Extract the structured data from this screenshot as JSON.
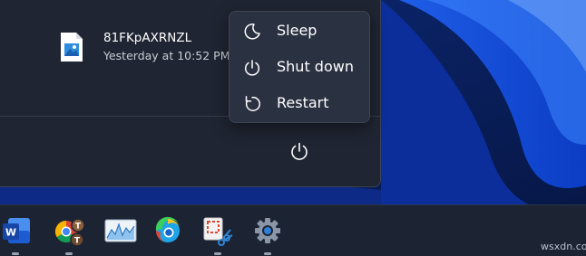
{
  "recent_file": {
    "name": "81FKpAXRNZL",
    "time": "Yesterday at 10:52 PM",
    "icon": "image-file-icon"
  },
  "power_menu": {
    "items": [
      {
        "label": "Sleep",
        "icon": "moon-icon"
      },
      {
        "label": "Shut down",
        "icon": "power-icon"
      },
      {
        "label": "Restart",
        "icon": "restart-icon"
      }
    ]
  },
  "power_button": {
    "icon": "power-icon"
  },
  "taskbar": {
    "apps": [
      {
        "name": "word",
        "icon": "word-icon",
        "running": true
      },
      {
        "name": "chrome",
        "icon": "chrome-icon",
        "running": true
      },
      {
        "name": "performance-monitor",
        "icon": "chart-icon",
        "running": false
      },
      {
        "name": "edge",
        "icon": "edge-icon",
        "running": false
      },
      {
        "name": "snipping-tool",
        "icon": "snipping-tool-icon",
        "running": true
      },
      {
        "name": "settings",
        "icon": "gear-icon",
        "running": true
      }
    ]
  },
  "watermark": "wsxdn.com",
  "colors": {
    "menu_bg": "#1f2532",
    "flyout_bg": "#2a3140",
    "taskbar_bg": "#1c2433",
    "wallpaper": "#0a1f55"
  }
}
